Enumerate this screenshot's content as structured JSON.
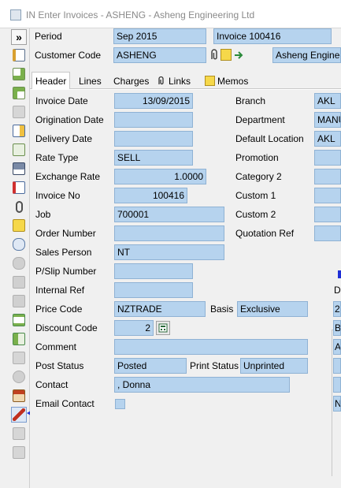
{
  "window": {
    "title": "IN Enter Invoices - ASHENG - Asheng Engineering Ltd"
  },
  "top": {
    "period_label": "Period",
    "period_value": "Sep 2015",
    "invoice_ref": "Invoice 100416",
    "customer_code_label": "Customer Code",
    "customer_code_value": "ASHENG",
    "customer_name": "Asheng Enginee"
  },
  "tabs": [
    {
      "label": "Header"
    },
    {
      "label": "Lines"
    },
    {
      "label": "Charges"
    },
    {
      "label": "Links"
    },
    {
      "label": "Memos"
    }
  ],
  "toolbar": {
    "collapse_label": "»"
  },
  "left": {
    "invoice_date_label": "Invoice Date",
    "invoice_date": "13/09/2015",
    "origination_date_label": "Origination Date",
    "origination_date": "",
    "delivery_date_label": "Delivery Date",
    "delivery_date": "",
    "rate_type_label": "Rate Type",
    "rate_type": "SELL",
    "exchange_rate_label": "Exchange Rate",
    "exchange_rate": "1.0000",
    "invoice_no_label": "Invoice No",
    "invoice_no": "100416",
    "job_label": "Job",
    "job": "700001",
    "order_number_label": "Order Number",
    "order_number": "",
    "sales_person_label": "Sales Person",
    "sales_person": "NT",
    "pslip_label": "P/Slip Number",
    "pslip": "",
    "internal_ref_label": "Internal Ref",
    "internal_ref": "",
    "price_code_label": "Price Code",
    "price_code": "NZTRADE",
    "basis_label": "Basis",
    "basis": "Exclusive",
    "discount_code_label": "Discount Code",
    "discount_code": "2",
    "comment_label": "Comment",
    "comment": "",
    "post_status_label": "Post Status",
    "post_status": "Posted",
    "print_status_label": "Print Status",
    "print_status": "Unprinted",
    "contact_label": "Contact",
    "contact": ", Donna",
    "email_contact_label": "Email Contact"
  },
  "right": {
    "branch_label": "Branch",
    "branch": "AKL",
    "department_label": "Department",
    "department": "MANU",
    "default_location_label": "Default Location",
    "default_location": "AKL",
    "promotion_label": "Promotion",
    "promotion": "",
    "category2_label": "Category 2",
    "category2": "",
    "custom1_label": "Custom 1",
    "custom1": "",
    "custom2_label": "Custom 2",
    "custom2": "",
    "quotation_ref_label": "Quotation Ref",
    "quotation_ref": "",
    "partial_d": "D",
    "partial_2": "2",
    "partial_b": "B",
    "partial_a": "A",
    "partial_n": "N"
  },
  "colors": {
    "field_bg": "#b6d3ee",
    "arrow": "#1f2fd6"
  }
}
